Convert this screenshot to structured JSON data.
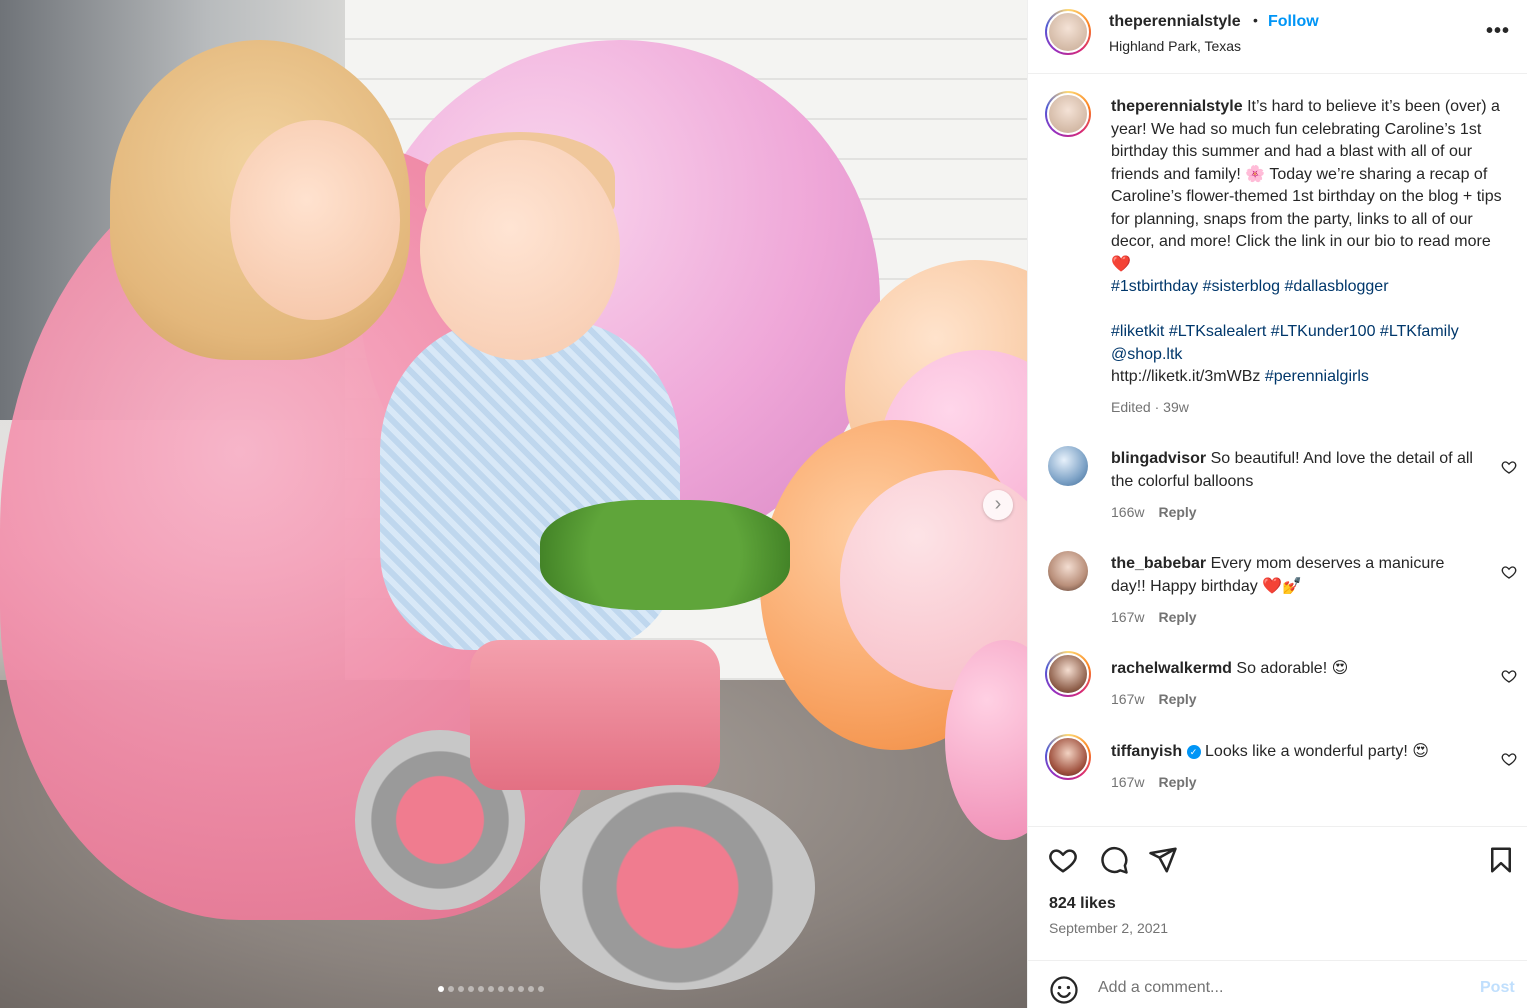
{
  "post": {
    "username": "theperennialstyle",
    "separator": "•",
    "follow_label": "Follow",
    "location": "Highland Park, Texas",
    "more_label": "•••"
  },
  "caption": {
    "username": "theperennialstyle",
    "text": "It’s hard to believe it’s been (over) a year! We had so much fun celebrating Caroline’s 1st birthday this summer and had a blast with all of our friends and family! 🌸 Today we’re sharing a recap of Caroline’s flower-themed 1st birthday on the blog + tips for planning, snaps from the party, links to all of our decor, and more! Click the link in our bio to read more ❤️",
    "hashtags1": [
      "#1stbirthday",
      "#sisterblog",
      "#dallasblogger"
    ],
    "hashtags2": [
      "#liketkit",
      "#LTKsalealert",
      "#LTKunder100",
      "#LTKfamily"
    ],
    "mention": "@shop.ltk",
    "link": "http://liketk.it/3mWBz",
    "link_tag": "#perennialgirls",
    "edited": "Edited",
    "time": "39w"
  },
  "comments": [
    {
      "username": "blingadvisor",
      "text": "So beautiful! And love the detail of all the colorful balloons",
      "time": "166w",
      "reply": "Reply",
      "verified": false
    },
    {
      "username": "the_babebar",
      "text": "Every mom deserves a manicure day!! Happy birthday ❤️💅",
      "time": "167w",
      "reply": "Reply",
      "verified": false
    },
    {
      "username": "rachelwalkermd",
      "text": "So adorable! 😍",
      "time": "167w",
      "reply": "Reply",
      "verified": false
    },
    {
      "username": "tiffanyish",
      "text": "Looks like a wonderful party! 😍",
      "time": "167w",
      "reply": "Reply",
      "verified": true
    }
  ],
  "stats": {
    "likes": "824 likes",
    "date": "September 2, 2021"
  },
  "compose": {
    "placeholder": "Add a comment...",
    "post_label": "Post"
  },
  "carousel": {
    "next_label": "›",
    "slide_count": 11,
    "active_index": 0
  },
  "colors": {
    "accent": "#0095f6",
    "hashtag": "#00376b",
    "muted": "#737373"
  }
}
